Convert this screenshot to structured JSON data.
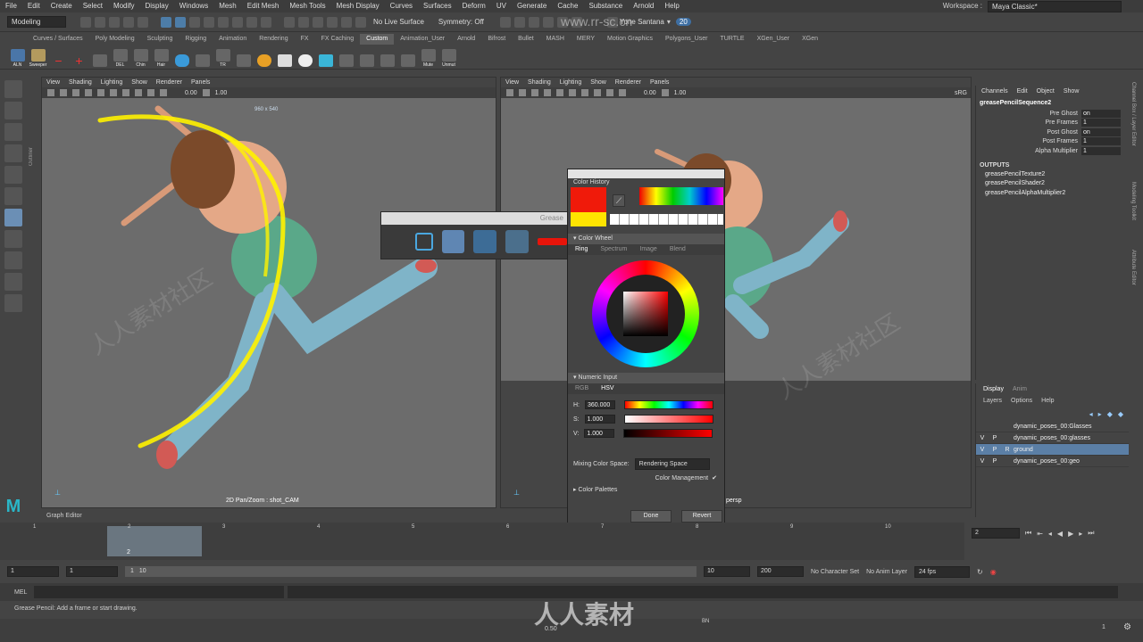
{
  "menubar": {
    "items": [
      "File",
      "Edit",
      "Create",
      "Select",
      "Modify",
      "Display",
      "Windows",
      "Mesh",
      "Edit Mesh",
      "Mesh Tools",
      "Mesh Display",
      "Curves",
      "Surfaces",
      "Deform",
      "UV",
      "Generate",
      "Cache",
      "Substance",
      "Arnold",
      "Help"
    ],
    "workspace_label": "Workspace :",
    "workspace_value": "Maya Classic*"
  },
  "statusline": {
    "mode": "Modeling",
    "live_surface": "No Live Surface",
    "symmetry": "Symmetry: Off",
    "user": "Yone Santana",
    "notifications": "20"
  },
  "shelf": {
    "tabs": [
      "Curves / Surfaces",
      "Poly Modeling",
      "Sculpting",
      "Rigging",
      "Animation",
      "Rendering",
      "FX",
      "FX Caching",
      "Custom",
      "Animation_User",
      "Arnold",
      "Bifrost",
      "Bullet",
      "MASH",
      "MERY",
      "Motion Graphics",
      "Polygons_User",
      "TURTLE",
      "XGen_User",
      "XGen"
    ],
    "active_tab": "Custom",
    "buttons": [
      "ALN",
      "Sweeper",
      "",
      "",
      "",
      "DEL",
      "Chin",
      "Hair",
      "",
      "",
      "TR",
      "",
      "",
      "",
      "",
      "",
      "",
      "",
      "",
      "",
      "Mute",
      "Unmut"
    ]
  },
  "toolbox": {
    "outliner_label": "Outliner"
  },
  "viewport_left": {
    "menu": [
      "View",
      "Shading",
      "Lighting",
      "Show",
      "Renderer",
      "Panels"
    ],
    "val1": "0.00",
    "val2": "1.00",
    "resolution": "960 x 540",
    "hud": "2D Pan/Zoom : shot_CAM"
  },
  "viewport_right": {
    "menu": [
      "View",
      "Shading",
      "Lighting",
      "Show",
      "Renderer",
      "Panels"
    ],
    "val1": "0.00",
    "val2": "1.00",
    "srgb": "sRG",
    "hud": "persp"
  },
  "grease": {
    "title": "Grease"
  },
  "color_dialog": {
    "history_label": "Color History",
    "wheel_section": "Color Wheel",
    "wheel_tabs": [
      "Ring",
      "Spectrum",
      "Image",
      "Blend"
    ],
    "numeric_section": "Numeric Input",
    "numeric_tabs": [
      "RGB",
      "HSV"
    ],
    "h_label": "H:",
    "h_value": "360.000",
    "s_label": "S:",
    "s_value": "1.000",
    "v_label": "V:",
    "v_value": "1.000",
    "mixing_label": "Mixing Color Space:",
    "mixing_value": "Rendering Space",
    "color_management": "Color Management",
    "palettes": "Color Palettes",
    "done": "Done",
    "revert": "Revert",
    "current_color": "#f01a0a",
    "previous_color": "#ffe400"
  },
  "channelbox": {
    "menu": [
      "Channels",
      "Edit",
      "Object",
      "Show"
    ],
    "node": "greasePencilSequence2",
    "attrs": [
      {
        "label": "Pre Ghost",
        "value": "on"
      },
      {
        "label": "Pre Frames",
        "value": "1"
      },
      {
        "label": "Post Ghost",
        "value": "on"
      },
      {
        "label": "Post Frames",
        "value": "1"
      },
      {
        "label": "Alpha Multiplier",
        "value": "1"
      }
    ],
    "outputs_label": "OUTPUTS",
    "outputs": [
      "greasePencilTexture2",
      "greasePencilShader2",
      "greasePencilAlphaMultiplier2"
    ]
  },
  "layers": {
    "tabs": [
      "Display",
      "Anim"
    ],
    "menu": [
      "Layers",
      "Options",
      "Help"
    ],
    "rows": [
      {
        "v": "",
        "p": "",
        "r": "",
        "name": "dynamic_poses_00:Glasses"
      },
      {
        "v": "V",
        "p": "P",
        "r": "",
        "name": "dynamic_poses_00:glasses"
      },
      {
        "v": "V",
        "p": "P",
        "r": "R",
        "name": "ground"
      },
      {
        "v": "V",
        "p": "P",
        "r": "",
        "name": "dynamic_poses_00:geo"
      }
    ]
  },
  "right_tabs": [
    "Channel Box / Layer Editor",
    "Modeling Toolkit",
    "Attribute Editor"
  ],
  "timeline": {
    "graph_editor": "Graph Editor",
    "ticks": [
      "1",
      "2",
      "3",
      "4",
      "5",
      "6",
      "7",
      "8",
      "9",
      "10"
    ],
    "current_frame": "2",
    "playhead_label": "2"
  },
  "range": {
    "start": "1",
    "start2": "1",
    "inner1": "1",
    "inner2": "10",
    "end": "10",
    "end2": "200",
    "character_set": "No Character Set",
    "anim_layer": "No Anim Layer",
    "fps": "24 fps"
  },
  "cmdline": {
    "label": "MEL"
  },
  "helpline": {
    "text": "Grease Pencil: Add a frame or start drawing."
  },
  "bottombar": {
    "value": "0.50",
    "tag": "BN",
    "frame": "1"
  },
  "watermark": {
    "main": "人人素材",
    "url": "www.rr-sc.cn",
    "repeat": "人人素材社区"
  }
}
